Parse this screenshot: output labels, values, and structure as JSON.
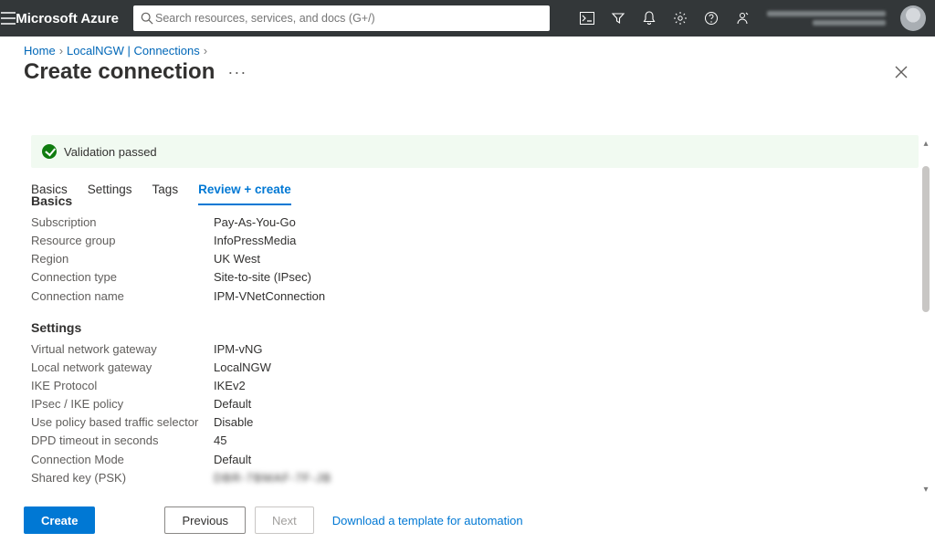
{
  "brand": "Microsoft Azure",
  "search": {
    "placeholder": "Search resources, services, and docs (G+/)"
  },
  "breadcrumbs": {
    "home": "Home",
    "parent": "LocalNGW | Connections"
  },
  "page": {
    "title": "Create connection"
  },
  "validation": {
    "text": "Validation passed"
  },
  "tabs": {
    "basics": "Basics",
    "settings": "Settings",
    "tags": "Tags",
    "review": "Review + create"
  },
  "sections": {
    "basics_title": "Basics",
    "settings_title": "Settings"
  },
  "basics": {
    "subscription_k": "Subscription",
    "subscription_v": "Pay-As-You-Go",
    "rg_k": "Resource group",
    "rg_v": "InfoPressMedia",
    "region_k": "Region",
    "region_v": "UK West",
    "conn_type_k": "Connection type",
    "conn_type_v": "Site-to-site (IPsec)",
    "conn_name_k": "Connection name",
    "conn_name_v": "IPM-VNetConnection"
  },
  "settings": {
    "vng_k": "Virtual network gateway",
    "vng_v": "IPM-vNG",
    "lng_k": "Local network gateway",
    "lng_v": "LocalNGW",
    "ike_k": "IKE Protocol",
    "ike_v": "IKEv2",
    "policy_k": "IPsec / IKE policy",
    "policy_v": "Default",
    "sel_k": "Use policy based traffic selector",
    "sel_v": "Disable",
    "dpd_k": "DPD timeout in seconds",
    "dpd_v": "45",
    "mode_k": "Connection Mode",
    "mode_v": "Default",
    "psk_k": "Shared key (PSK)",
    "psk_v": "DBR-7BMAF-7F-JB"
  },
  "footer": {
    "create": "Create",
    "previous": "Previous",
    "next": "Next",
    "download": "Download a template for automation"
  }
}
